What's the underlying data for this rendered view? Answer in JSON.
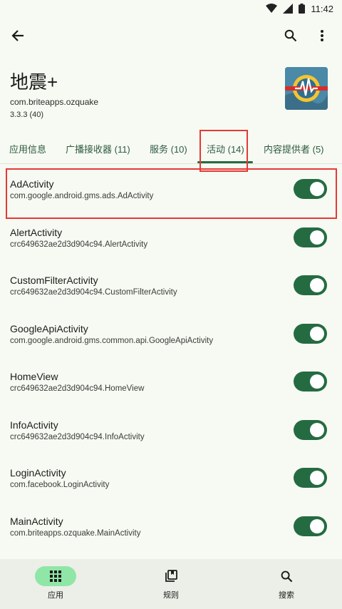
{
  "status_bar": {
    "time": "11:42"
  },
  "app": {
    "name": "地震+",
    "package": "com.briteapps.ozquake",
    "version": "3.3.3 (40)"
  },
  "tabs": [
    {
      "label": "应用信息"
    },
    {
      "label": "广播接收器 (11)"
    },
    {
      "label": "服务 (10)"
    },
    {
      "label": "活动 (14)",
      "selected": true
    },
    {
      "label": "内容提供者 (5)"
    }
  ],
  "activities": [
    {
      "name": "AdActivity",
      "class": "com.google.android.gms.ads.AdActivity",
      "enabled": true
    },
    {
      "name": "AlertActivity",
      "class": "crc649632ae2d3d904c94.AlertActivity",
      "enabled": true
    },
    {
      "name": "CustomFilterActivity",
      "class": "crc649632ae2d3d904c94.CustomFilterActivity",
      "enabled": true
    },
    {
      "name": "GoogleApiActivity",
      "class": "com.google.android.gms.common.api.GoogleApiActivity",
      "enabled": true
    },
    {
      "name": "HomeView",
      "class": "crc649632ae2d3d904c94.HomeView",
      "enabled": true
    },
    {
      "name": "InfoActivity",
      "class": "crc649632ae2d3d904c94.InfoActivity",
      "enabled": true
    },
    {
      "name": "LoginActivity",
      "class": "com.facebook.LoginActivity",
      "enabled": true
    },
    {
      "name": "MainActivity",
      "class": "com.briteapps.ozquake.MainActivity",
      "enabled": true
    }
  ],
  "bottom_nav": [
    {
      "label": "应用",
      "icon": "apps-grid-icon",
      "selected": true
    },
    {
      "label": "规则",
      "icon": "rules-icon"
    },
    {
      "label": "搜索",
      "icon": "search-icon"
    }
  ],
  "colors": {
    "accent": "#256b41",
    "background": "#f7faf3",
    "highlight": "#e53935"
  }
}
